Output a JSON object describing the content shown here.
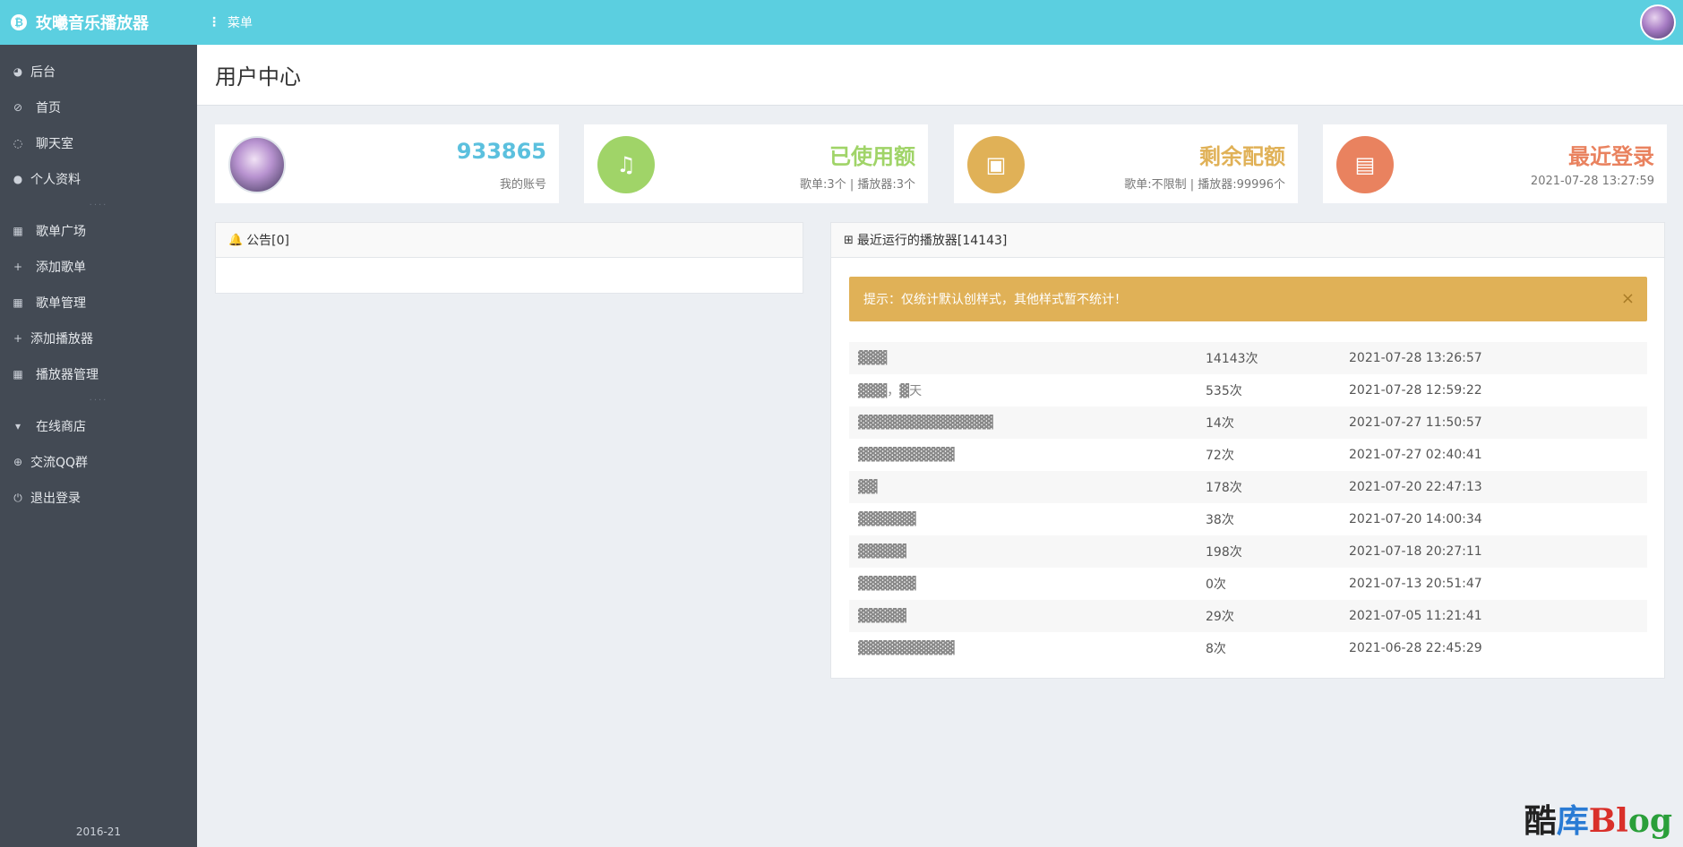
{
  "app": {
    "title": "玫曦音乐播放器",
    "logo_glyph": "₿",
    "menu_label": "菜单",
    "menu_glyph": "⋮"
  },
  "sidebar": {
    "items": [
      {
        "label": "后台",
        "icon": "pie-chart-icon",
        "glyph": "◕"
      },
      {
        "label": "首页",
        "icon": "compass-icon",
        "glyph": "⊘"
      },
      {
        "label": "聊天室",
        "icon": "chat-icon",
        "glyph": "◌"
      },
      {
        "label": "个人资料",
        "icon": "user-icon",
        "glyph": "●"
      },
      {
        "label": "歌单广场",
        "icon": "grid-icon",
        "glyph": "▦"
      },
      {
        "label": "添加歌单",
        "icon": "plus-icon",
        "glyph": "+"
      },
      {
        "label": "歌单管理",
        "icon": "grid-icon",
        "glyph": "▦"
      },
      {
        "label": "添加播放器",
        "icon": "plus-icon",
        "glyph": "+"
      },
      {
        "label": "播放器管理",
        "icon": "grid-icon",
        "glyph": "▦"
      },
      {
        "label": "在线商店",
        "icon": "cart-icon",
        "glyph": "▾"
      },
      {
        "label": "交流QQ群",
        "icon": "globe-icon",
        "glyph": "⊕"
      },
      {
        "label": "退出登录",
        "icon": "power-icon",
        "glyph": "⏻"
      }
    ],
    "separator": "····",
    "footer": "2016-21"
  },
  "page": {
    "title": "用户中心"
  },
  "cards": [
    {
      "value": "933865",
      "sub": "我的账号",
      "color": "#5bc0de",
      "icon": "avatar"
    },
    {
      "value": "已使用额",
      "sub": "歌单:3个 | 播放器:3个",
      "color": "#a0d468",
      "icon": "music-icon",
      "glyph": "♫"
    },
    {
      "value": "剩余配额",
      "sub": "歌单:不限制 | 播放器:99996个",
      "color": "#e0b157",
      "icon": "briefcase-icon",
      "glyph": "▣"
    },
    {
      "value": "最近登录",
      "sub": "2021-07-28 13:27:59",
      "color": "#e9825f",
      "icon": "wallet-icon",
      "glyph": "▤"
    }
  ],
  "notice": {
    "title": "公告[0]",
    "icon": "bell-icon",
    "glyph": "🔔"
  },
  "recent": {
    "title": "最近运行的播放器[14143]",
    "icon": "map-icon",
    "glyph": "⊞",
    "alert": "提示：仅统计默认创样式，其他样式暂不统计！",
    "close": "×",
    "rows": [
      {
        "name": "▓▓▓",
        "count": "14143次",
        "time": "2021-07-28 13:26:57"
      },
      {
        "name": "▓▓▓，▓天",
        "count": "535次",
        "time": "2021-07-28 12:59:22"
      },
      {
        "name": "▓▓▓▓▓▓▓▓▓▓▓▓▓▓",
        "count": "14次",
        "time": "2021-07-27 11:50:57"
      },
      {
        "name": "▓▓▓▓▓▓▓▓▓▓",
        "count": "72次",
        "time": "2021-07-27 02:40:41"
      },
      {
        "name": "▓▓",
        "count": "178次",
        "time": "2021-07-20 22:47:13"
      },
      {
        "name": "▓▓▓▓▓▓",
        "count": "38次",
        "time": "2021-07-20 14:00:34"
      },
      {
        "name": "▓▓▓▓▓",
        "count": "198次",
        "time": "2021-07-18 20:27:11"
      },
      {
        "name": "▓▓▓▓▓▓",
        "count": "0次",
        "time": "2021-07-13 20:51:47"
      },
      {
        "name": "▓▓▓▓▓",
        "count": "29次",
        "time": "2021-07-05 11:21:41"
      },
      {
        "name": "▓▓▓▓▓▓▓▓▓▓",
        "count": "8次",
        "time": "2021-06-28 22:45:29"
      }
    ]
  },
  "watermark": {
    "p1": "酷",
    "p2": "库",
    "p3": "Bl",
    "p4": "og"
  }
}
